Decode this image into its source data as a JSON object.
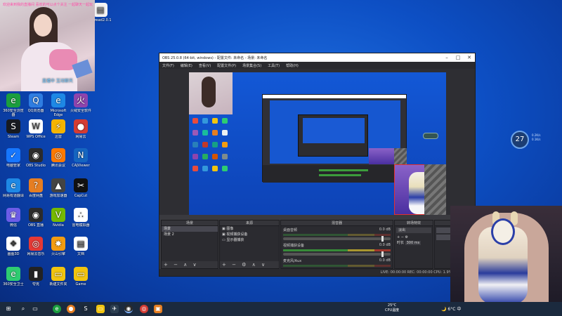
{
  "desktop": {
    "top_icon_label": "weread2.0.1",
    "icons": [
      {
        "label": "360安全浏览器",
        "icon": "browser-360-icon",
        "color": "#1b9e3e",
        "glyph": "e"
      },
      {
        "label": "QQ浏览器",
        "icon": "qq-browser-icon",
        "color": "#2f7de1",
        "glyph": "Q"
      },
      {
        "label": "Microsoft Edge",
        "icon": "edge-icon",
        "color": "#1e88e5",
        "glyph": "e"
      },
      {
        "label": "火绒安全软件",
        "icon": "huorong-icon",
        "color": "#8e44ad",
        "glyph": "火"
      },
      {
        "label": "Steam",
        "icon": "steam-icon",
        "color": "#171a21",
        "glyph": "S"
      },
      {
        "label": "WPS Office",
        "icon": "wps-icon",
        "color": "#ffffff",
        "glyph": "W"
      },
      {
        "label": "迅雷",
        "icon": "thunder-icon",
        "color": "#f5b400",
        "glyph": "⚡"
      },
      {
        "label": "网易云",
        "icon": "netease-icon",
        "color": "#d43c33",
        "glyph": "●"
      },
      {
        "label": "电脑管家",
        "icon": "pc-manager-icon",
        "color": "#1677ff",
        "glyph": "✓"
      },
      {
        "label": "OBS Studio",
        "icon": "obs-icon",
        "color": "#2b2b2b",
        "glyph": "◉"
      },
      {
        "label": "腾讯会议",
        "icon": "tencent-meeting-icon",
        "color": "#ff7a00",
        "glyph": "◎"
      },
      {
        "label": "CAJViewer",
        "icon": "cajviewer-icon",
        "color": "#1565c0",
        "glyph": "N"
      },
      {
        "label": "网易有道翻译",
        "icon": "youdao-icon",
        "color": "#1e88e5",
        "glyph": "e"
      },
      {
        "label": "百度网盘",
        "icon": "baidu-netdisk-icon",
        "color": "#e67e22",
        "glyph": "?"
      },
      {
        "label": "游戏加速器",
        "icon": "game-booster-icon",
        "color": "#444444",
        "glyph": "▲"
      },
      {
        "label": "CapCut",
        "icon": "capcut-icon",
        "color": "#111111",
        "glyph": "✂"
      },
      {
        "label": "微信",
        "icon": "wechat-icon",
        "color": "#6c5ce7",
        "glyph": "♛"
      },
      {
        "label": "OBS 直播",
        "icon": "obs-live-icon",
        "color": "#2b2b2b",
        "glyph": "◉"
      },
      {
        "label": "Nvidia",
        "icon": "nvidia-icon",
        "color": "#76b900",
        "glyph": "V"
      },
      {
        "label": "雷电模拟器",
        "icon": "ldplayer-icon",
        "color": "#ffffff",
        "glyph": "∴"
      },
      {
        "label": "画图3D",
        "icon": "paint3d-icon",
        "color": "#ffffff",
        "glyph": "❖"
      },
      {
        "label": "网易云音乐",
        "icon": "cloud-music-icon",
        "color": "#e53935",
        "glyph": "◎"
      },
      {
        "label": "火山引擎",
        "icon": "volcano-icon",
        "color": "#f39c12",
        "glyph": "✸"
      },
      {
        "label": "文档",
        "icon": "doc-icon",
        "color": "#ffffff",
        "glyph": "▤"
      },
      {
        "label": "360安全卫士",
        "icon": "security-guard-icon",
        "color": "#2ecc71",
        "glyph": "e"
      },
      {
        "label": "夸克",
        "icon": "quark-icon",
        "color": "#222222",
        "glyph": "▮"
      },
      {
        "label": "新建文件夹",
        "icon": "folder-icon",
        "color": "#f1c40f",
        "glyph": "▭"
      },
      {
        "label": "Game",
        "icon": "game-folder-icon",
        "color": "#f1c40f",
        "glyph": "▭"
      }
    ]
  },
  "stream_overlay": {
    "scrolling_text": "欢迎来到我的直播间 喜欢的可以点个关注 一起聊天一起玩",
    "cam_caption": "直播中 互动聊天"
  },
  "obs": {
    "title": "OBS 25.0.8 (64-bit, windows) - 配置文件: 未命名 - 场景: 未命名",
    "menu": [
      "文件(F)",
      "编辑(E)",
      "查看(V)",
      "配置文件(P)",
      "场景集合(S)",
      "工具(T)",
      "帮助(H)"
    ],
    "scenes_panel": {
      "title": "场景",
      "items": [
        "场景",
        "场景 2"
      ]
    },
    "sources_panel": {
      "title": "来源",
      "items": [
        "图像",
        "视频捕获设备",
        "显示器捕获"
      ]
    },
    "mixer_panel": {
      "title": "混音器",
      "channels": [
        {
          "name": "桌面音频",
          "db": "0.0 dB"
        },
        {
          "name": "视频捕获设备",
          "db": "0.0 dB"
        },
        {
          "name": "麦克风/Aux",
          "db": "0.0 dB"
        }
      ]
    },
    "transitions_panel": {
      "title": "转场特效",
      "mode": "淡出",
      "duration_label": "时长",
      "duration": "300 ms"
    },
    "controls_label": "工",
    "status": "LIVE: 00:00:00   REC: 00:00:00   CPU: 1.9%, 30.00 fps"
  },
  "widget": {
    "temp": "27",
    "line1": "0.2K/s",
    "line2": "0.1K/s"
  },
  "taskbar": {
    "weather": "25°C",
    "weather_desc": "CPU温度",
    "tray_temp": "6°C",
    "ime": "中"
  }
}
